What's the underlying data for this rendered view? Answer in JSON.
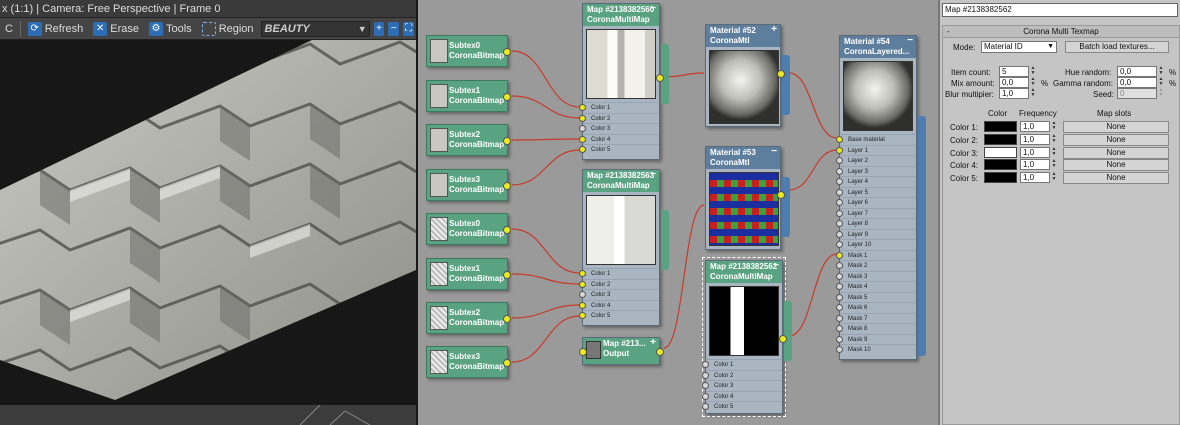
{
  "viewport": {
    "title": "x (1:1) | Camera: Free Perspective | Frame 0",
    "toolbar": {
      "clear_label": "C",
      "refresh_label": "Refresh",
      "erase_label": "Erase",
      "tools_label": "Tools",
      "region_label": "Region",
      "render_element": "BEAUTY"
    }
  },
  "node_editor": {
    "subtex_nodes": [
      {
        "name": "Subtex0",
        "type": "CoronaBitmap"
      },
      {
        "name": "Subtex1",
        "type": "CoronaBitmap"
      },
      {
        "name": "Subtex2",
        "type": "CoronaBitmap"
      },
      {
        "name": "Subtex3",
        "type": "CoronaBitmap"
      },
      {
        "name": "Subtex0",
        "type": "CoronaBitmap"
      },
      {
        "name": "Subtex1",
        "type": "CoronaBitmap"
      },
      {
        "name": "Subtex2",
        "type": "CoronaBitmap"
      },
      {
        "name": "Subtex3",
        "type": "CoronaBitmap"
      }
    ],
    "multimap_a": {
      "name": "Map #2138382560",
      "type": "CoronaMultiMap",
      "slots": [
        "Color 1",
        "Color 2",
        "Color 3",
        "Color 4",
        "Color 5"
      ]
    },
    "multimap_b": {
      "name": "Map #2138382563",
      "type": "CoronaMultiMap",
      "slots": [
        "Color 1",
        "Color 2",
        "Color 3",
        "Color 4",
        "Color 5"
      ]
    },
    "output_node": {
      "name": "Map #213...",
      "type": "Output"
    },
    "material_52": {
      "name": "Material #52",
      "type": "CoronaMtl"
    },
    "material_53": {
      "name": "Material #53",
      "type": "CoronaMtl"
    },
    "multimap_c": {
      "name": "Map #2138382562",
      "type": "CoronaMultiMap",
      "slots": [
        "Color 1",
        "Color 2",
        "Color 3",
        "Color 4",
        "Color 5"
      ]
    },
    "material_54": {
      "name": "Material #54",
      "type": "CoronaLayered...",
      "slots": [
        "Base material",
        "Layer 1",
        "Layer 2",
        "Layer 3",
        "Layer 4",
        "Layer 5",
        "Layer 6",
        "Layer 7",
        "Layer 8",
        "Layer 9",
        "Layer 10",
        "Mask 1",
        "Mask 2",
        "Mask 3",
        "Mask 4",
        "Mask 5",
        "Mask 6",
        "Mask 7",
        "Mask 8",
        "Mask 9",
        "Mask 10"
      ]
    },
    "wire_color": "#c83a2a"
  },
  "props": {
    "map_name": "Map #2138382562",
    "rollout_title": "Corona Multi Texmap",
    "rollout_toggle": "-",
    "mode_label": "Mode:",
    "mode_value": "Material ID",
    "batch_button": "Batch load textures...",
    "item_count_label": "Item count:",
    "item_count": "5",
    "mix_amount_label": "Mix amount:",
    "mix_amount": "0,0",
    "blur_label": "Blur multipier:",
    "blur": "1,0",
    "hue_random_label": "Hue random:",
    "hue_random": "0,0",
    "gamma_random_label": "Gamma random:",
    "gamma_random": "0,0",
    "seed_label": "Seed:",
    "seed": "0",
    "percent": "%",
    "col_color": "Color",
    "col_frequency": "Frequency",
    "col_map_slots": "Map slots",
    "rows": [
      {
        "label": "Color 1:",
        "color": "#000000",
        "frequency": "1,0",
        "map": "None"
      },
      {
        "label": "Color 2:",
        "color": "#000000",
        "frequency": "1,0",
        "map": "None"
      },
      {
        "label": "Color 3:",
        "color": "#ffffff",
        "frequency": "1,0",
        "map": "None"
      },
      {
        "label": "Color 4:",
        "color": "#000000",
        "frequency": "1,0",
        "map": "None"
      },
      {
        "label": "Color 5:",
        "color": "#000000",
        "frequency": "1,0",
        "map": "None"
      }
    ]
  }
}
